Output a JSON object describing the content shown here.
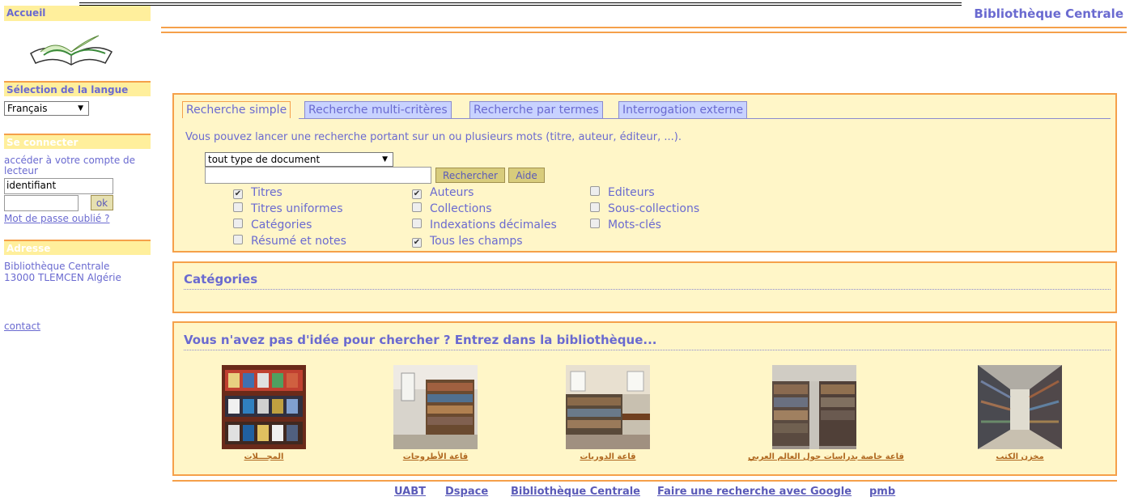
{
  "site_title": "Bibliothèque Centrale",
  "sidebar": {
    "home": "Accueil",
    "lang_title": "Sélection de la langue",
    "lang_selected": "Français",
    "login_title": "Se connecter",
    "login_text": "accéder à votre compte de lecteur",
    "login_field": "identifiant",
    "ok_label": "ok",
    "forgot_link": "Mot de passe oublié ?",
    "address_title": "Adresse",
    "address_line1": "Bibliothèque Centrale",
    "address_line2": "13000 TLEMCEN Algérie",
    "contact": "contact"
  },
  "search": {
    "tabs": [
      "Recherche simple",
      "Recherche multi-critères",
      "Recherche par termes",
      "Interrogation externe"
    ],
    "hint": "Vous pouvez lancer une recherche portant sur un ou plusieurs mots (titre, auteur, éditeur, ...).",
    "doc_type": "tout type de document",
    "search_button": "Rechercher",
    "help_button": "Aide",
    "checkboxes": [
      {
        "label": "Titres",
        "checked": true
      },
      {
        "label": "Auteurs",
        "checked": true
      },
      {
        "label": "Editeurs",
        "checked": false
      },
      {
        "label": "Titres uniformes",
        "checked": false
      },
      {
        "label": "Collections",
        "checked": false
      },
      {
        "label": "Sous-collections",
        "checked": false
      },
      {
        "label": "Catégories",
        "checked": false
      },
      {
        "label": "Indexations décimales",
        "checked": false
      },
      {
        "label": "Mots-clés",
        "checked": false
      },
      {
        "label": "Résumé et notes",
        "checked": false
      },
      {
        "label": "Tous les champs",
        "checked": true
      }
    ]
  },
  "categories": {
    "title": "Catégories"
  },
  "browse": {
    "title": "Vous n'avez pas d'idée pour chercher ? Entrez dans la bibliothèque...",
    "items": [
      {
        "label": "المجـــلات"
      },
      {
        "label": "قاعة الأطروحات"
      },
      {
        "label": "قاعة الدوريات"
      },
      {
        "label": "قاعة خاصة بدراسات حول العالم العربي"
      },
      {
        "label": "مخزن الكتب"
      }
    ]
  },
  "footer": {
    "links": [
      "UABT",
      "Dspace",
      "Bibliothèque Centrale",
      "Faire une recherche avec Google",
      "pmb"
    ]
  },
  "colors": {
    "accent": "#f5a04a",
    "panel": "#fff6c8",
    "text": "#6a6ad0",
    "tab": "#c8d2ff"
  }
}
